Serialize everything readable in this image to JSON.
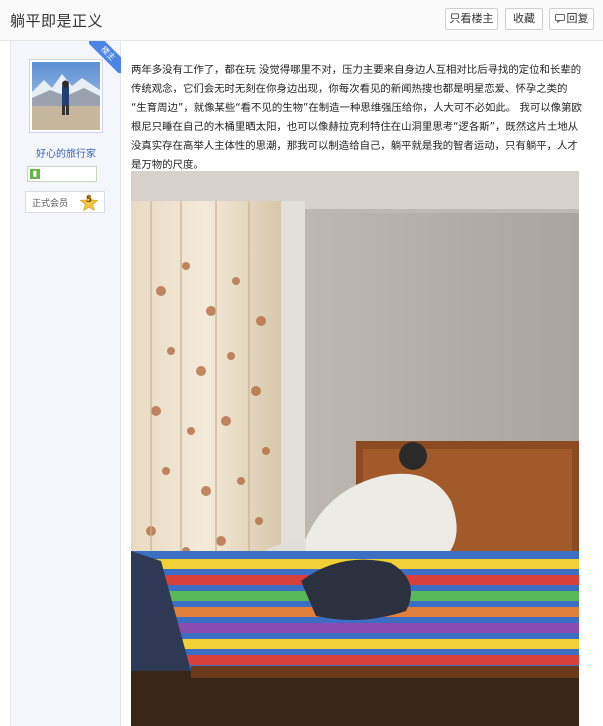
{
  "thread": {
    "title": "躺平即是正义"
  },
  "toolbar": {
    "only_op_label": "只看楼主",
    "favorite_label": "收藏",
    "reply_label": "回复"
  },
  "author": {
    "username": "好心的旅行家",
    "op_badge": "楼主",
    "member_label": "正式会员",
    "member_level": "5",
    "level_icon": "level-badge-icon"
  },
  "post": {
    "body": "两年多没有工作了，都在玩 没觉得哪里不对，压力主要来自身边人互相对比后寻找的定位和长辈的传统观念，它们会无时无刻在你身边出现，你每次看见的新闻热搜也都是明星恋爱、怀孕之类的 “生育周边”，就像某些“看不见的生物”在制造一种思维强压给你，人大可不必如此。 我可以像第欧根尼只睡在自己的木桶里晒太阳，也可以像赫拉克利特住在山洞里思考“逻各斯”，既然这片土地从没真实存在高举人主体性的思潮，那我可以制造给自己，躺平就是我的智者运动，只有躺平，人才是万物的尺度。",
    "photo_description": "bedroom-photo"
  },
  "colors": {
    "accent": "#4a86e8",
    "link": "#3a62b3",
    "sidebar_bg": "#f4f6fb"
  }
}
